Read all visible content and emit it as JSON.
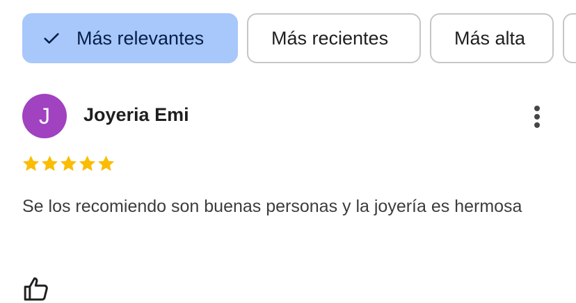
{
  "filters": {
    "chips": [
      {
        "label": "Más relevantes",
        "selected": true,
        "icon": "check-icon"
      },
      {
        "label": "Más recientes",
        "selected": false
      },
      {
        "label": "Más alta",
        "selected": false
      },
      {
        "label": "",
        "selected": false
      }
    ]
  },
  "review": {
    "avatar_initial": "J",
    "avatar_color": "#a142c0",
    "author": "Joyeria Emi",
    "rating": 5,
    "rating_max": 5,
    "star_color": "#fbbc04",
    "text": "Se los recomiendo son buenas personas y la joyería es hermosa",
    "more_icon": "more-vert-icon",
    "like_icon": "thumb-up-icon"
  },
  "colors": {
    "chip_selected_bg": "#a8c7fa",
    "chip_border": "#c4c7c5"
  }
}
